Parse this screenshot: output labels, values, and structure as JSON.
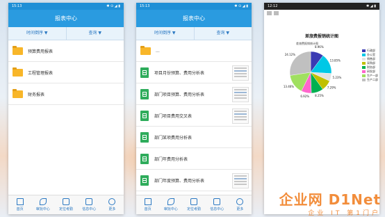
{
  "screen1": {
    "status_time": "15:13",
    "status_icons": "✱ ⊙ ◢ ▮",
    "title": "报表中心",
    "filters": [
      "时间倒序 ▼",
      "查询 ▼"
    ],
    "folders": [
      "预算费用报表",
      "工程管理报表",
      "财务报表"
    ]
  },
  "screen2": {
    "status_time": "15:13",
    "status_icons": "✱ ⊙ ◢ ▮",
    "title": "报表中心",
    "filters": [
      "时间倒序 ▼",
      "查询 ▼"
    ],
    "parent_folder": "...",
    "files": [
      "项目月份预算、费用分析表",
      "部门项目预算、费用分析表",
      "部门项目费用交叉表",
      "部门某项费用分析表",
      "部门年费用分析表",
      "部门年度预算、费用分析表"
    ]
  },
  "tabs": [
    "首页",
    "审批中心",
    "定位考勤",
    "信息中心",
    "更多"
  ],
  "screen3": {
    "status_time": "12:12",
    "status_icons": "✱ ◢ ▮",
    "chart_title": "差旅费报销统计图",
    "chart_subtitle": "差旅费报销统计图"
  },
  "chart_data": {
    "type": "pie",
    "title": "差旅费报销统计图",
    "slices": [
      {
        "label": "行政部",
        "value": 8.96,
        "color": "#3b3bb3"
      },
      {
        "label": "办公室",
        "value": 13.85,
        "color": "#00c8e6"
      },
      {
        "label": "销售部",
        "value": 5.23,
        "color": "#e3e3e3"
      },
      {
        "label": "采购部",
        "value": 7.29,
        "color": "#c0c000"
      },
      {
        "label": "财务部",
        "value": 8.25,
        "color": "#00b050"
      },
      {
        "label": "研发部",
        "value": 6.92,
        "color": "#ff66cc"
      },
      {
        "label": "生产一部",
        "value": 13.46,
        "color": "#a0e060"
      },
      {
        "label": "生产二部",
        "value": 24.12,
        "color": "#c0c0c0"
      }
    ]
  },
  "watermark": {
    "main": "企业网 D1Net",
    "sub": "企业 IT 第1门户"
  }
}
